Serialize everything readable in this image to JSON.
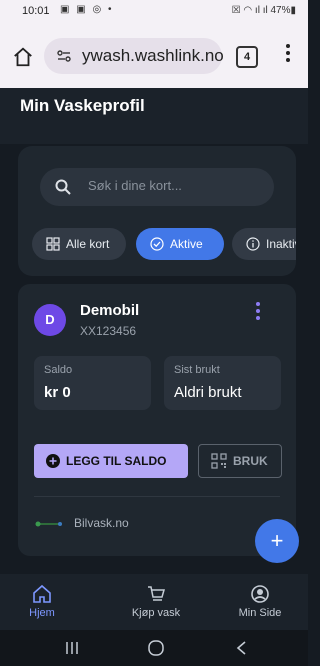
{
  "status_bar": {
    "time": "10:01",
    "icons": "▣ ▣ ◎ •",
    "right": "☒ ◠ ıl ıl 47%▮"
  },
  "browser": {
    "url": "ywash.washlink.no",
    "tabs_count": "4"
  },
  "app": {
    "title": "Min Vaskeprofil"
  },
  "search": {
    "placeholder": "Søk i dine kort..."
  },
  "filters": [
    {
      "label": "Alle kort",
      "icon": "grid-icon",
      "active": false
    },
    {
      "label": "Aktive",
      "icon": "check-circle-icon",
      "active": true
    },
    {
      "label": "Inaktive",
      "icon": "info-circle-icon",
      "active": false
    }
  ],
  "card": {
    "avatar_letter": "D",
    "name": "Demobil",
    "plate": "XX123456",
    "balance_label": "Saldo",
    "balance_value": "kr 0",
    "last_used_label": "Sist brukt",
    "last_used_value": "Aldri brukt",
    "add_balance_label": "LEGG TIL SALDO",
    "use_label": "BRUK",
    "provider": "Bilvask.no"
  },
  "fab": {
    "label": "+"
  },
  "bottom_nav": [
    {
      "label": "Hjem",
      "icon": "home-icon",
      "active": true
    },
    {
      "label": "Kjøp vask",
      "icon": "cart-icon",
      "active": false
    },
    {
      "label": "Min Side",
      "icon": "account-circle-icon",
      "active": false
    }
  ],
  "colors": {
    "background": "#151b22",
    "surface": "#1f272f",
    "accent": "#4278e8",
    "avatar": "#6e49e6",
    "add_button": "#b4a7f7",
    "nav_active": "#7d97ff"
  }
}
